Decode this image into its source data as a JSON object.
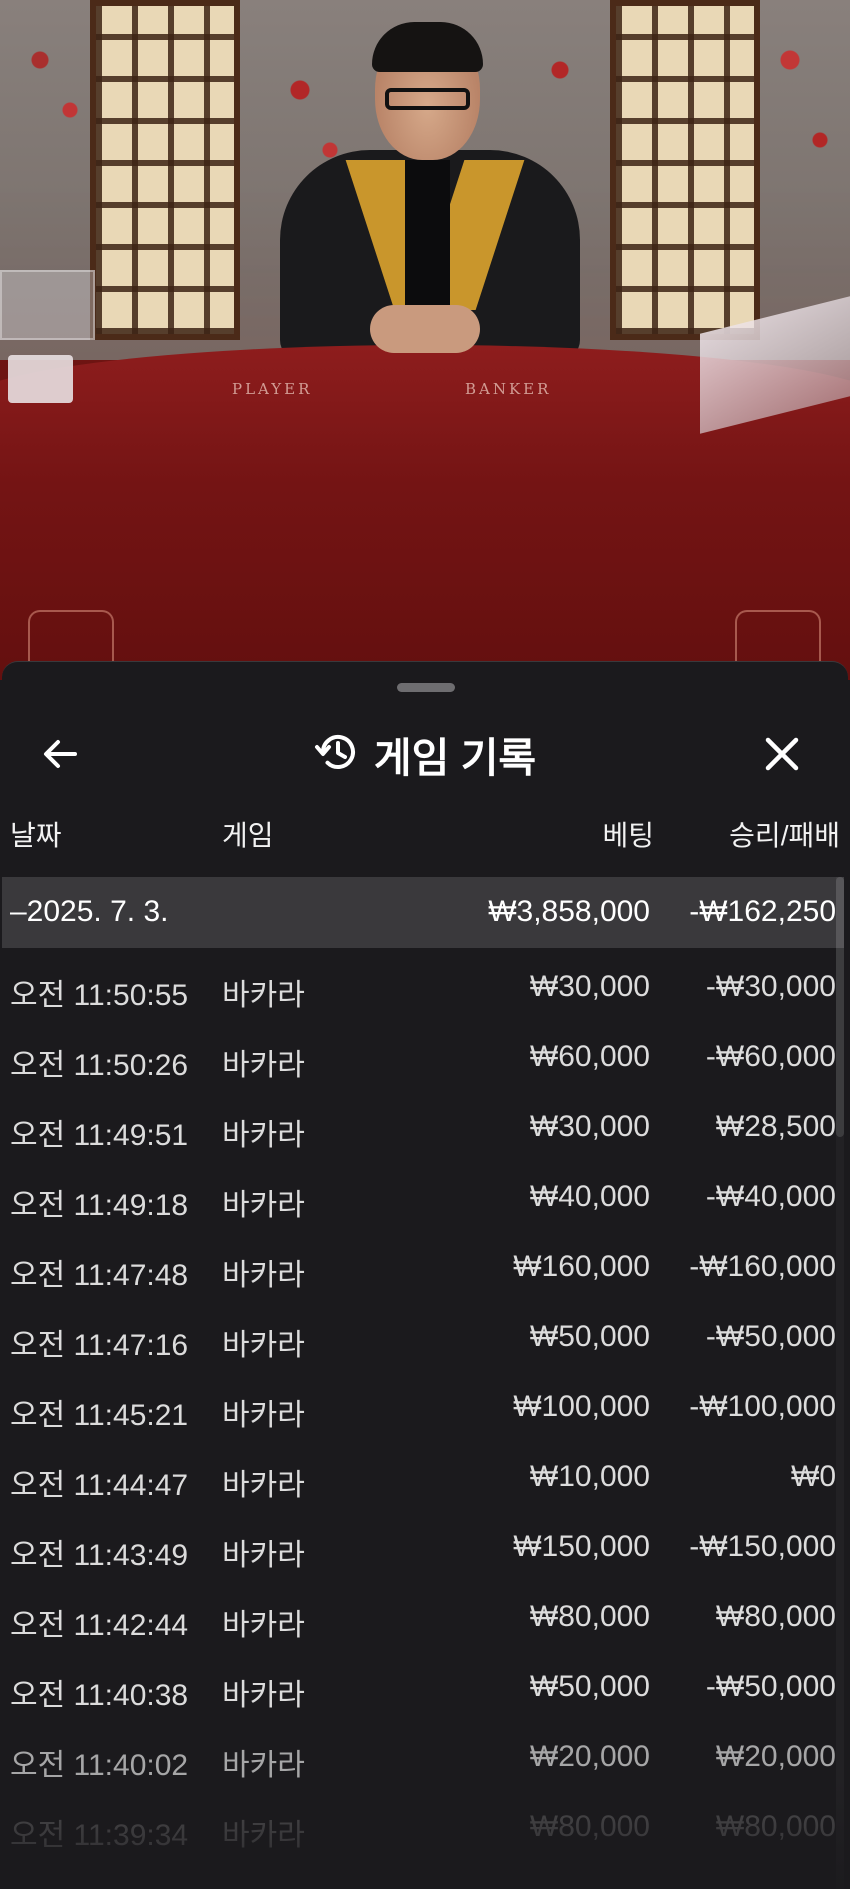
{
  "video": {
    "table_labels": {
      "player": "PLAYER",
      "banker": "BANKER"
    }
  },
  "sheet": {
    "title": "게임 기록",
    "icons": {
      "back": "arrow-left-icon",
      "history": "history-clock-icon",
      "close": "close-x-icon"
    }
  },
  "columns": {
    "date": "날짜",
    "game": "게임",
    "bet": "베팅",
    "win_loss": "승리/패배"
  },
  "day_summary": {
    "date": "–2025. 7. 3.",
    "bet": "₩3,858,000",
    "win_loss": "-₩162,250"
  },
  "rows": [
    {
      "time": "오전 11:50:55",
      "game": "바카라",
      "bet": "₩30,000",
      "win_loss": "-₩30,000"
    },
    {
      "time": "오전 11:50:26",
      "game": "바카라",
      "bet": "₩60,000",
      "win_loss": "-₩60,000"
    },
    {
      "time": "오전 11:49:51",
      "game": "바카라",
      "bet": "₩30,000",
      "win_loss": "₩28,500"
    },
    {
      "time": "오전 11:49:18",
      "game": "바카라",
      "bet": "₩40,000",
      "win_loss": "-₩40,000"
    },
    {
      "time": "오전 11:47:48",
      "game": "바카라",
      "bet": "₩160,000",
      "win_loss": "-₩160,000"
    },
    {
      "time": "오전 11:47:16",
      "game": "바카라",
      "bet": "₩50,000",
      "win_loss": "-₩50,000"
    },
    {
      "time": "오전 11:45:21",
      "game": "바카라",
      "bet": "₩100,000",
      "win_loss": "-₩100,000"
    },
    {
      "time": "오전 11:44:47",
      "game": "바카라",
      "bet": "₩10,000",
      "win_loss": "₩0"
    },
    {
      "time": "오전 11:43:49",
      "game": "바카라",
      "bet": "₩150,000",
      "win_loss": "-₩150,000"
    },
    {
      "time": "오전 11:42:44",
      "game": "바카라",
      "bet": "₩80,000",
      "win_loss": "₩80,000"
    },
    {
      "time": "오전 11:40:38",
      "game": "바카라",
      "bet": "₩50,000",
      "win_loss": "-₩50,000"
    },
    {
      "time": "오전 11:40:02",
      "game": "바카라",
      "bet": "₩20,000",
      "win_loss": "₩20,000"
    },
    {
      "time": "오전 11:39:34",
      "game": "바카라",
      "bet": "₩80,000",
      "win_loss": "₩80,000"
    }
  ]
}
